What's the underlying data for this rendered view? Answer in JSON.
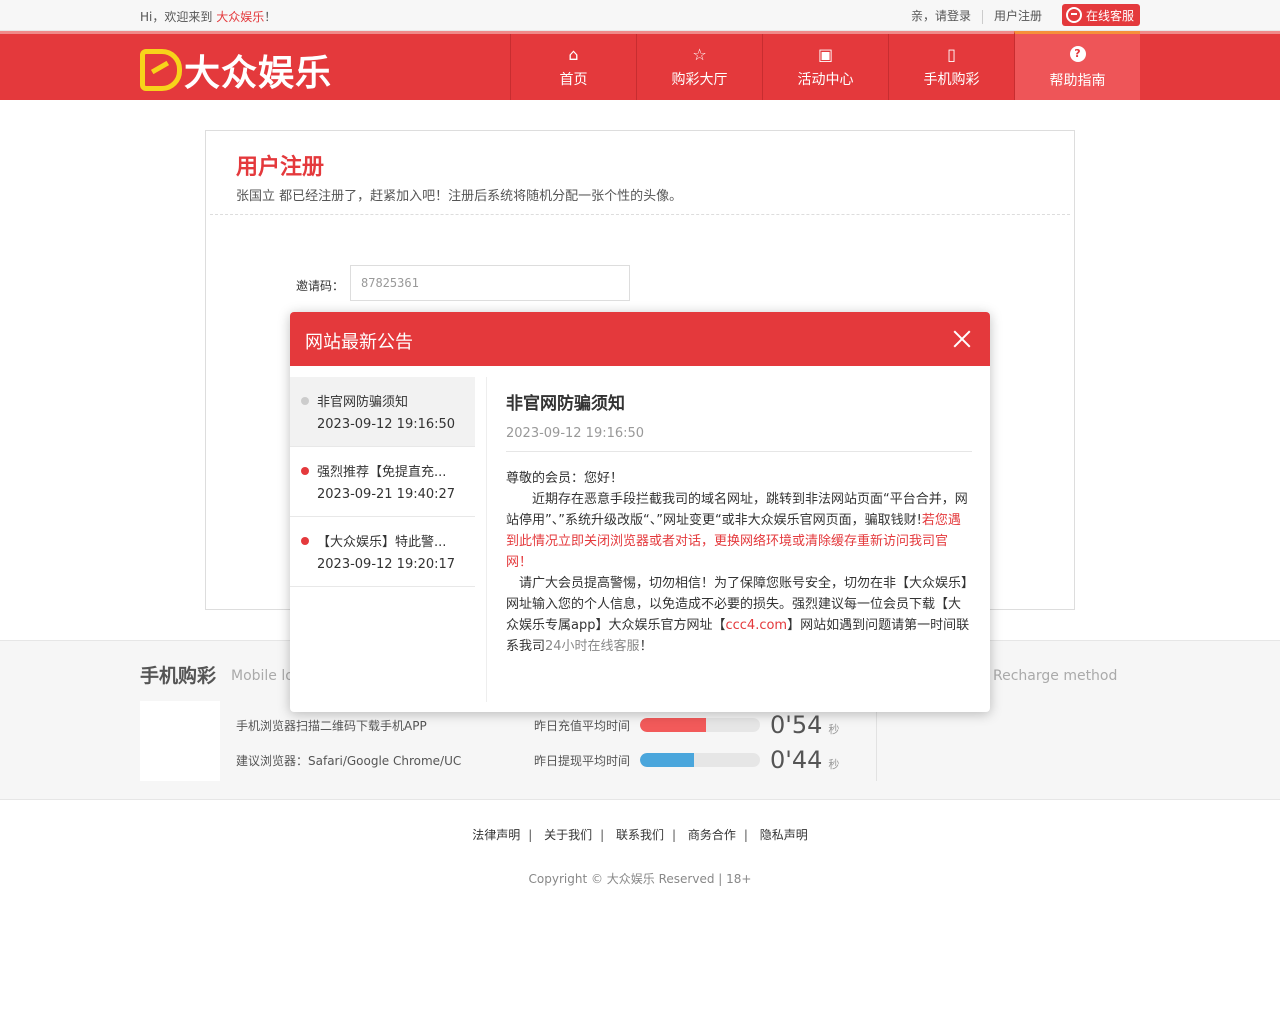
{
  "topbar": {
    "welcome_prefix": "Hi，欢迎来到",
    "brand": "大众娱乐",
    "welcome_suffix": "！",
    "login": "亲，请登录",
    "register": "用户注册",
    "service": "在线客服"
  },
  "header": {
    "logo_text": "大众娱乐",
    "nav": [
      {
        "label": "首页",
        "icon": "home-icon"
      },
      {
        "label": "购彩大厅",
        "icon": "star-icon"
      },
      {
        "label": "活动中心",
        "icon": "gift-icon"
      },
      {
        "label": "手机购彩",
        "icon": "mobile-icon"
      },
      {
        "label": "帮助指南",
        "icon": "help-icon"
      }
    ]
  },
  "register": {
    "title": "用户注册",
    "subtitle": "张国立 都已经注册了，赶紧加入吧！注册后系统将随机分配一张个性的头像。",
    "invite_label": "邀请码：",
    "invite_value": "87825361"
  },
  "modal": {
    "title": "网站最新公告",
    "list": [
      {
        "title": "非官网防骗须知",
        "date": "2023-09-12 19:16:50"
      },
      {
        "title": "强烈推荐【免提直充...",
        "date": "2023-09-21 19:40:27"
      },
      {
        "title": "【大众娱乐】特此警...",
        "date": "2023-09-12 19:20:17"
      }
    ],
    "content": {
      "title": "非官网防骗须知",
      "date": "2023-09-12 19:16:50",
      "greeting": "尊敬的会员：您好！",
      "p1a": "近期存在恶意手段拦截我司的域名网址，跳转到非法网站页面“平台合并，网站停用”、”系统升级改版“、”网址变更“或非大众娱乐官网页面，骗取钱财!",
      "p1b": "若您遇到此情况立即关闭浏览器或者对话，更换网络环境或清除缓存重新访问我司官网！",
      "p2a": "请广大会员提高警惕，切勿相信！为了保障您账号安全，切勿在非【大众娱乐】网址输入您的个人信息，以免造成不必要的损失。强烈建议每一位会员下载【大众娱乐专属app】大众娱乐官方网址【",
      "p2link": "ccc4.com",
      "p2b": "】网站如遇到问题请第一时间联系我司",
      "p2c": "24小时在线客服",
      "p2d": "！"
    }
  },
  "footer": {
    "mobile_title": "手机购彩",
    "mobile_sub": "Mobile lot",
    "recharge_sub": "Recharge method",
    "qr_tip1": "手机浏览器扫描二维码下载手机APP",
    "qr_tip2": "建议浏览器：Safari/Google Chrome/UC",
    "stats": [
      {
        "label": "昨日充值平均时间",
        "value": "0'54",
        "unit": "秒",
        "fill": 0.55,
        "color": "#f25a5a"
      },
      {
        "label": "昨日提现平均时间",
        "value": "0'44",
        "unit": "秒",
        "fill": 0.45,
        "color": "#4aa6dc"
      }
    ],
    "links": [
      "法律声明",
      "关于我们",
      "联系我们",
      "商务合作",
      "隐私声明"
    ],
    "link_sep": "|",
    "copyright": "Copyright © 大众娱乐 Reserved | 18+"
  }
}
